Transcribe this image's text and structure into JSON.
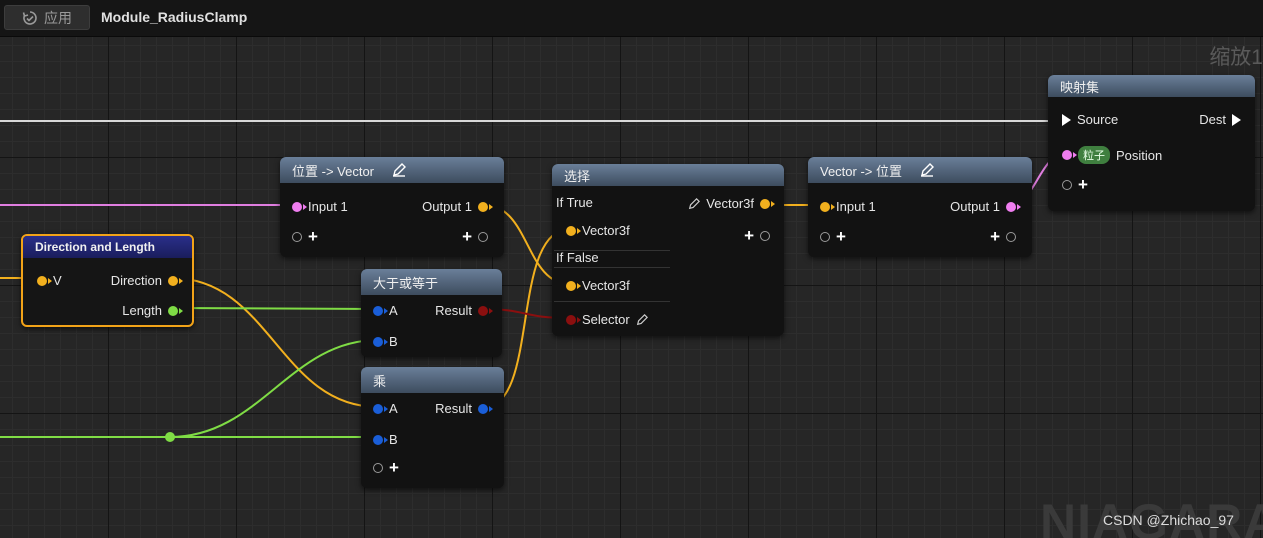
{
  "toolbar": {
    "apply_label": "应用",
    "apply_icon": "undo-circle-icon",
    "title": "Module_RadiusClamp"
  },
  "graph": {
    "zoom_label": "缩放1",
    "watermark_big": "NIAGARA",
    "watermark": "CSDN @Zhichao_97"
  },
  "colors": {
    "vector": "#f2b01e",
    "float": "#7fdc45",
    "position": "#f07ef0",
    "bool": "#8b0f0f",
    "result_blue": "#1a5ed8",
    "particle_tag": "#3f7f3f"
  },
  "nodes": {
    "dir_len": {
      "title": "Direction and Length",
      "in_v": "V",
      "out_dir": "Direction",
      "out_len": "Length"
    },
    "pos_to_vec": {
      "title": "位置 -> Vector",
      "in": "Input 1",
      "out": "Output 1"
    },
    "gte": {
      "title": "大于或等于",
      "a": "A",
      "b": "B",
      "result": "Result"
    },
    "mul": {
      "title": "乘",
      "a": "A",
      "b": "B",
      "result": "Result"
    },
    "select": {
      "title": "选择",
      "if_true": "If True",
      "if_false": "If False",
      "vtrue": "Vector3f",
      "vfalse": "Vector3f",
      "out": "Vector3f",
      "selector": "Selector"
    },
    "vec_to_pos": {
      "title": "Vector -> 位置",
      "in": "Input 1",
      "out": "Output 1"
    },
    "map_set": {
      "title": "映射集",
      "source": "Source",
      "dest": "Dest",
      "tag": "粒子",
      "position": "Position"
    }
  }
}
